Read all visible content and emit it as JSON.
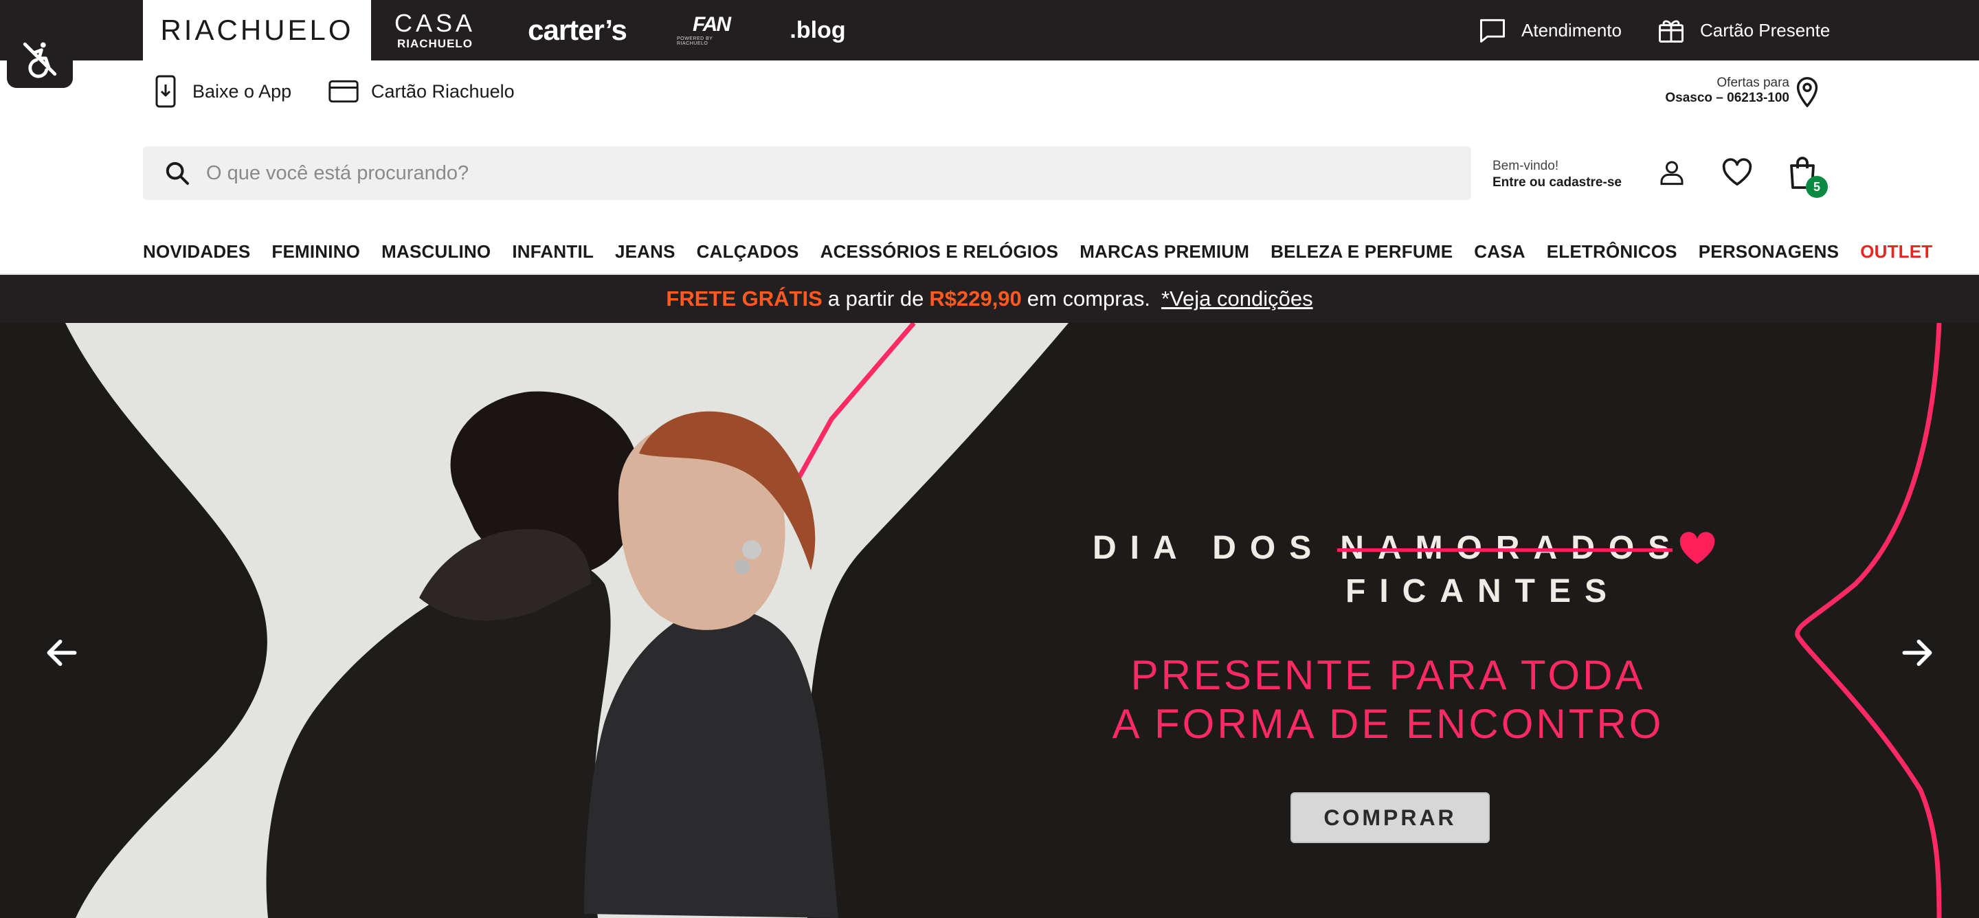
{
  "brandbar": {
    "brands": [
      "RIACHUELO",
      "CASA",
      "RIACHUELO",
      "carter’s",
      "FAN",
      "POWERED BY RIACHUELO",
      ".blog"
    ],
    "atendimento": "Atendimento",
    "gift_card": "Cartão Presente"
  },
  "subrow": {
    "app": "Baixe o App",
    "card": "Cartão Riachuelo",
    "offers_label": "Ofertas para",
    "offers_location": "Osasco – 06213-100"
  },
  "search": {
    "placeholder": "O que você está procurando?"
  },
  "account": {
    "welcome": "Bem-vindo!",
    "login": "Entre ou cadastre-se",
    "bag_count": "5"
  },
  "nav": {
    "items": [
      "NOVIDADES",
      "FEMININO",
      "MASCULINO",
      "INFANTIL",
      "JEANS",
      "CALÇADOS",
      "ACESSÓRIOS E RELÓGIOS",
      "MARCAS PREMIUM",
      "BELEZA E PERFUME",
      "CASA",
      "ELETRÔNICOS",
      "PERSONAGENS",
      "OUTLET"
    ]
  },
  "promo": {
    "free": "FRETE GRÁTIS",
    "from": "a partir de",
    "value": "R$229,90",
    "suffix": "em compras.",
    "link": "*Veja condições"
  },
  "hero": {
    "line1_a": "DIA DOS",
    "line1_strike": "NAMORADOS",
    "line2": "FICANTES",
    "sub1": "PRESENTE PARA TODA",
    "sub2": "A FORMA DE ENCONTRO",
    "cta": "COMPRAR"
  },
  "colors": {
    "dark": "#231f20",
    "accent_orange": "#ff5a1f",
    "accent_pink": "#ff2a64",
    "outlet_red": "#e8261f",
    "badge_green": "#0b8a43"
  }
}
